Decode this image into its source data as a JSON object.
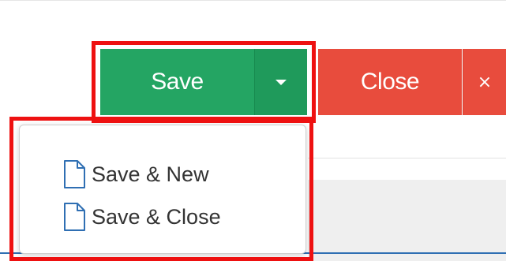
{
  "toolbar": {
    "save_label": "Save",
    "close_label": "Close",
    "x_label": "×"
  },
  "save_menu": {
    "items": [
      {
        "label": "Save & New",
        "icon": "file-icon"
      },
      {
        "label": "Save & Close",
        "icon": "file-icon"
      }
    ]
  },
  "colors": {
    "save_green": "#24a563",
    "save_caret_green": "#1f9a5b",
    "close_red": "#e84c3d",
    "highlight_red": "#ee1111",
    "file_icon_blue": "#2f6fb3"
  }
}
